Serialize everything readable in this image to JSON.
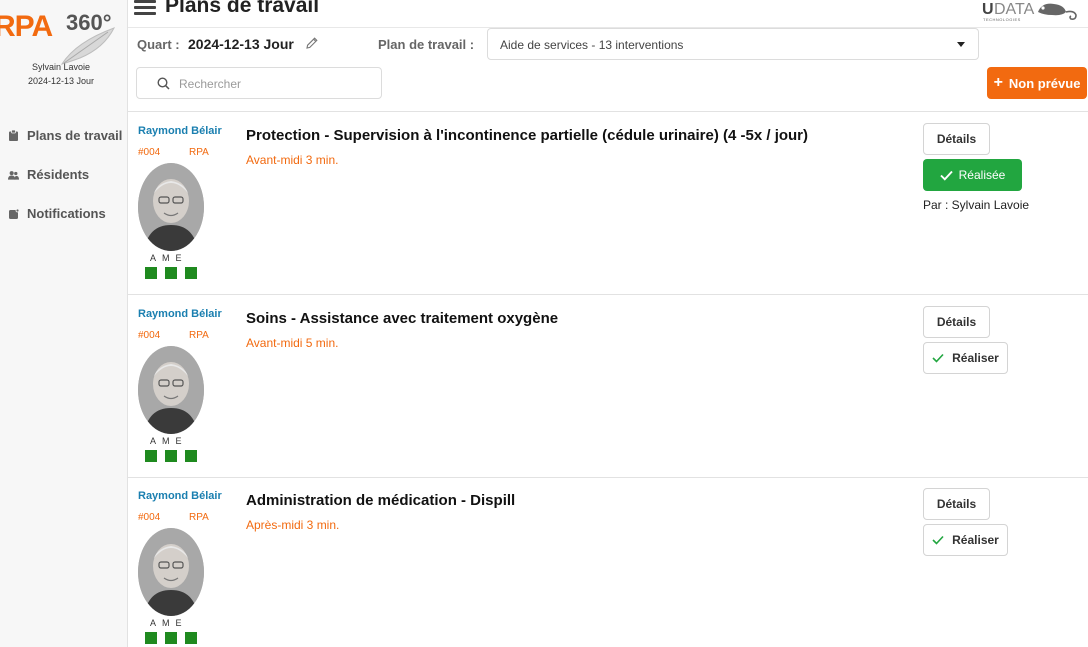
{
  "sidebar": {
    "logo_text": "RPA",
    "logo_number": "360°",
    "user_name": "Sylvain Lavoie",
    "user_shift": "2024-12-13 Jour",
    "items": [
      {
        "label": "Plans de travail",
        "icon": "clipboard-icon"
      },
      {
        "label": "Résidents",
        "icon": "users-icon"
      },
      {
        "label": "Notifications",
        "icon": "notification-icon"
      }
    ]
  },
  "header": {
    "title": "Plans de travail",
    "brand_u": "U",
    "brand_data": "DATA",
    "brand_sub": "TECHNOLOGIES",
    "quart_label": "Quart :",
    "quart_value": "2024-12-13 Jour",
    "plan_label": "Plan de travail :",
    "plan_value": "Aide de services - 13 interventions",
    "search_placeholder": "Rechercher",
    "non_prevue_plus": "+",
    "non_prevue_label": "Non prévue"
  },
  "colors": {
    "accent": "#f26a10",
    "link": "#1a7fb0",
    "success": "#22a640",
    "square": "#1f8a1f"
  },
  "tasks": [
    {
      "resident_name": "Raymond Bélair",
      "resident_id": "#004",
      "resident_type": "RPA",
      "ame": "AME",
      "title": "Protection - Supervision à l'incontinence partielle (cédule urinaire) (4 -5x / jour)",
      "time": "Avant-midi 3 min.",
      "details_label": "Détails",
      "status": "done",
      "action_label": "Réalisée",
      "done_by": "Par : Sylvain Lavoie"
    },
    {
      "resident_name": "Raymond Bélair",
      "resident_id": "#004",
      "resident_type": "RPA",
      "ame": "AME",
      "title": "Soins - Assistance avec traitement oxygène",
      "time": "Avant-midi 5 min.",
      "details_label": "Détails",
      "status": "todo",
      "action_label": "Réaliser"
    },
    {
      "resident_name": "Raymond Bélair",
      "resident_id": "#004",
      "resident_type": "RPA",
      "ame": "AME",
      "title": "Administration de médication - Dispill",
      "time": "Après-midi 3 min.",
      "details_label": "Détails",
      "status": "todo",
      "action_label": "Réaliser"
    }
  ]
}
